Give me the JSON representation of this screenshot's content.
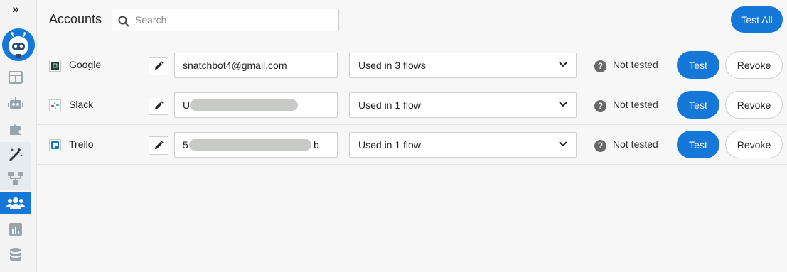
{
  "sidebar": {
    "expand_glyph": "»",
    "avatar": "bot-avatar",
    "items": [
      {
        "name": "dashboard-icon"
      },
      {
        "name": "bot-icon"
      },
      {
        "name": "integrations-icon"
      },
      {
        "name": "magic-wand-icon"
      },
      {
        "name": "flows-icon"
      },
      {
        "name": "accounts-icon",
        "active": true
      },
      {
        "name": "analytics-icon"
      },
      {
        "name": "database-icon"
      }
    ]
  },
  "header": {
    "title": "Accounts",
    "search_placeholder": "Search",
    "test_all_label": "Test All"
  },
  "accounts": [
    {
      "service": "Google",
      "icon": "google-sheets-icon",
      "credential_prefix": "snatchbot4@gmail.com",
      "credential_suffix": "",
      "flows": "Used in 3 flows",
      "status": "Not tested",
      "test_label": "Test",
      "revoke_label": "Revoke"
    },
    {
      "service": "Slack",
      "icon": "slack-icon",
      "credential_prefix": "U",
      "credential_suffix": "",
      "flows": "Used in 1 flow",
      "status": "Not tested",
      "test_label": "Test",
      "revoke_label": "Revoke"
    },
    {
      "service": "Trello",
      "icon": "trello-icon",
      "credential_prefix": "5",
      "credential_suffix": "b",
      "flows": "Used in 1 flow",
      "status": "Not tested",
      "test_label": "Test",
      "revoke_label": "Revoke"
    }
  ],
  "status_glyph": "?",
  "colors": {
    "accent": "#1577d8",
    "redaction": "#c7cac7",
    "status_icon": "#666666"
  }
}
